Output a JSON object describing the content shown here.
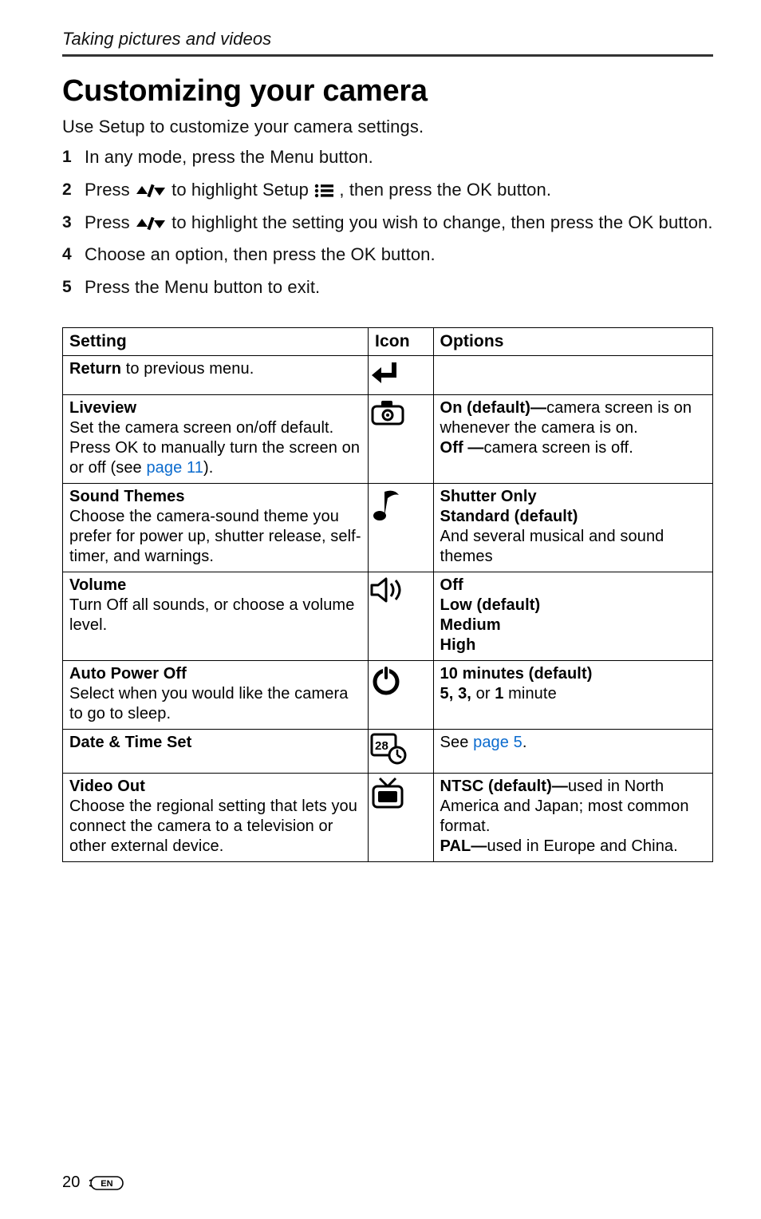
{
  "running_head": "Taking pictures and videos",
  "title": "Customizing your camera",
  "intro": "Use Setup to customize your camera settings.",
  "steps": {
    "s1": "In any mode, press the Menu button.",
    "s2a": "Press ",
    "s2b": " to highlight Setup ",
    "s2c": ", then press the OK button.",
    "s3a": "Press ",
    "s3b": " to highlight the setting you wish to change, then press the OK button.",
    "s4": "Choose an option, then press the OK button.",
    "s5": "Press the Menu button to exit."
  },
  "table": {
    "head": {
      "setting": "Setting",
      "icon": "Icon",
      "options": "Options"
    },
    "rows": {
      "return": {
        "name": "Return",
        "rest": " to previous menu."
      },
      "liveview": {
        "name": "Liveview",
        "desc1": "Set the camera screen on/off default. Press OK to manually turn the screen on or off (see ",
        "link": "page 11",
        "desc2": ").",
        "opt1a": "On (default)—",
        "opt1b": "camera screen is on whenever the camera is on.",
        "opt2a": "Off —",
        "opt2b": "camera screen is off."
      },
      "sound": {
        "name": "Sound Themes",
        "desc": "Choose the camera-sound theme you prefer for power up, shutter release, self-timer, and warnings.",
        "opt1": "Shutter Only",
        "opt2": "Standard (default)",
        "opt3": "And several musical and sound themes"
      },
      "volume": {
        "name": "Volume",
        "desc": "Turn Off all sounds, or choose a volume level.",
        "opt1": "Off",
        "opt2": "Low (default)",
        "opt3": "Medium",
        "opt4": "High"
      },
      "autopower": {
        "name": "Auto Power Off",
        "desc": "Select when you would like the camera to go to sleep.",
        "opt1": "10 minutes (default)",
        "opt2a": "5, 3,",
        "opt2b": " or ",
        "opt2c": "1",
        "opt2d": " minute"
      },
      "datetime": {
        "name": "Date & Time Set",
        "opt_pre": "See ",
        "opt_link": "page 5",
        "opt_post": "."
      },
      "videoout": {
        "name": "Video Out",
        "desc": "Choose the regional setting that lets you connect the camera to a television or other external device.",
        "opt1a": "NTSC (default)—",
        "opt1b": "used in North America and Japan; most common format.",
        "opt2a": "PAL—",
        "opt2b": "used in Europe and China."
      }
    }
  },
  "footer": {
    "page": "20",
    "lang": "EN"
  }
}
